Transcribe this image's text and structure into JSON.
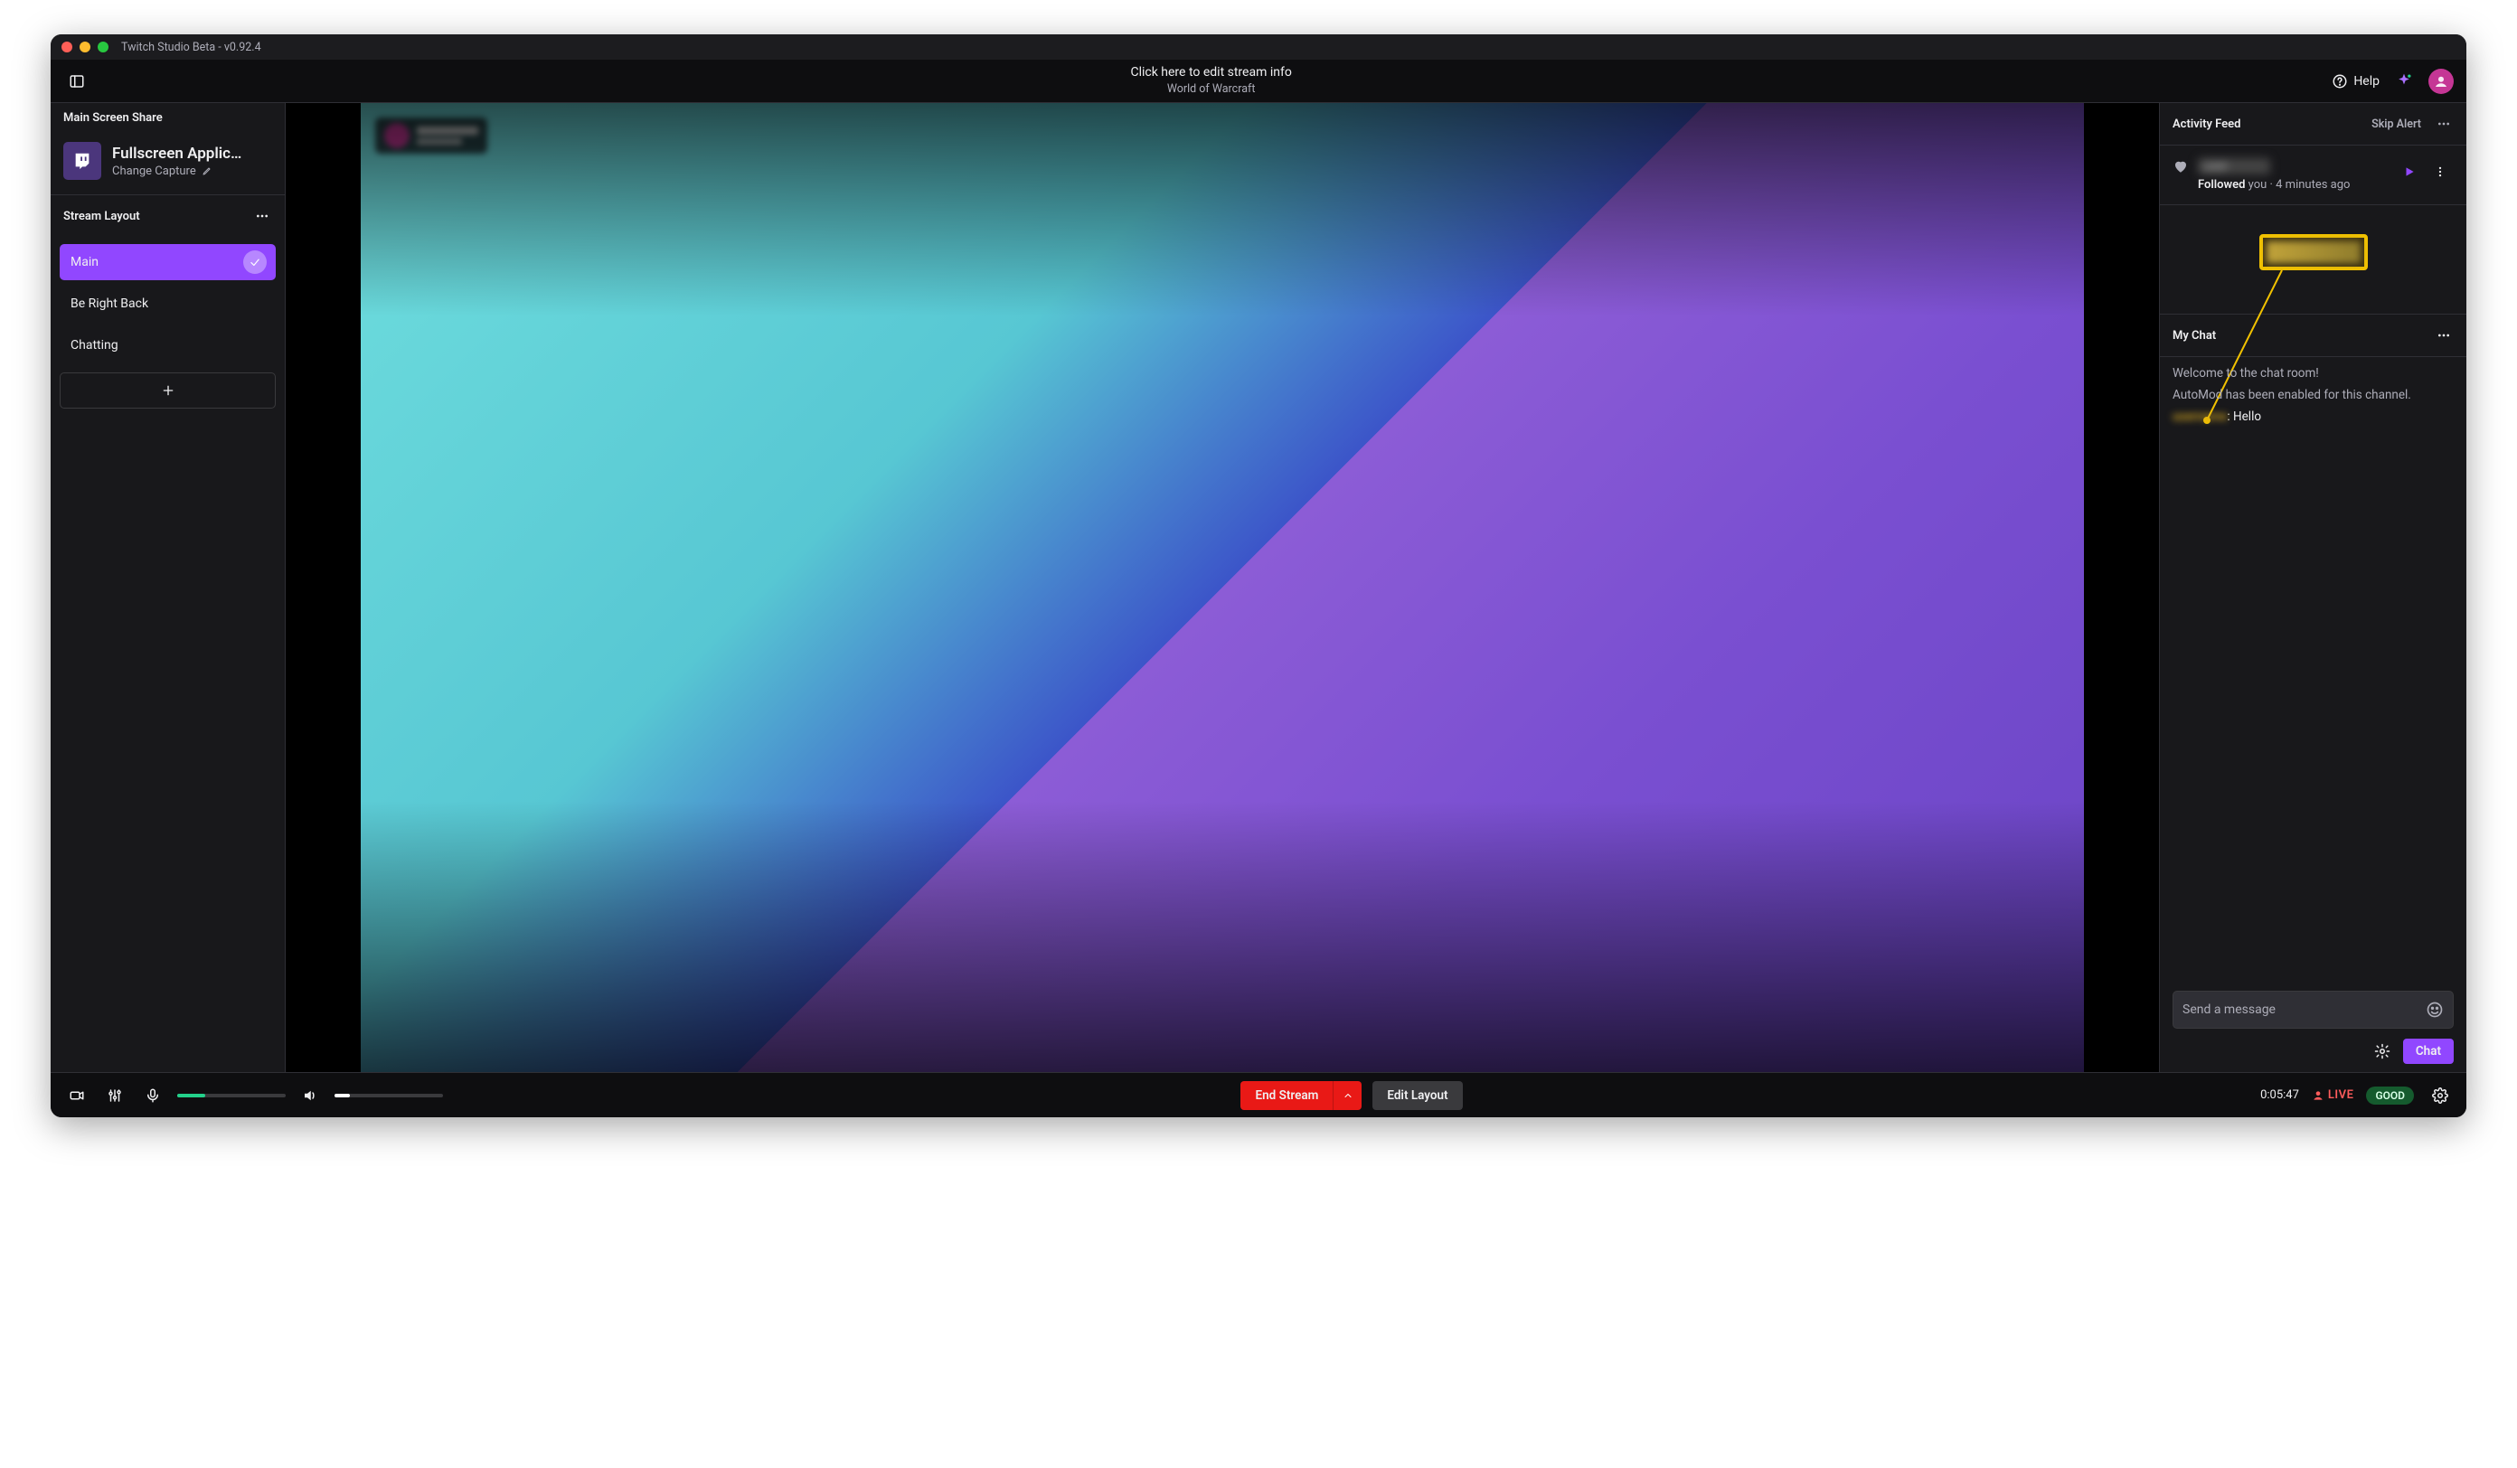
{
  "titlebar": {
    "app_title": "Twitch Studio Beta - v0.92.4"
  },
  "header": {
    "title": "Click here to edit stream info",
    "subtitle": "World of Warcraft",
    "help_label": "Help"
  },
  "sidebar": {
    "section_title": "Main Screen Share",
    "capture": {
      "title": "Fullscreen Applic…",
      "change_label": "Change Capture"
    },
    "layout_label": "Stream Layout",
    "scenes": [
      {
        "label": "Main",
        "active": true
      },
      {
        "label": "Be Right Back",
        "active": false
      },
      {
        "label": "Chatting",
        "active": false
      }
    ]
  },
  "activity": {
    "title": "Activity Feed",
    "skip_label": "Skip Alert",
    "item": {
      "followed_label": "Followed",
      "you_suffix": "you",
      "time": "4 minutes ago"
    }
  },
  "chat": {
    "title": "My Chat",
    "welcome": "Welcome to the chat room!",
    "automod": "AutoMod has been enabled for this channel.",
    "message_text": "Hello",
    "input_placeholder": "Send a message",
    "send_label": "Chat"
  },
  "bottombar": {
    "end_label": "End Stream",
    "edit_layout_label": "Edit Layout",
    "time": "0:05:47",
    "live_label": "LIVE",
    "quality_label": "GOOD"
  }
}
